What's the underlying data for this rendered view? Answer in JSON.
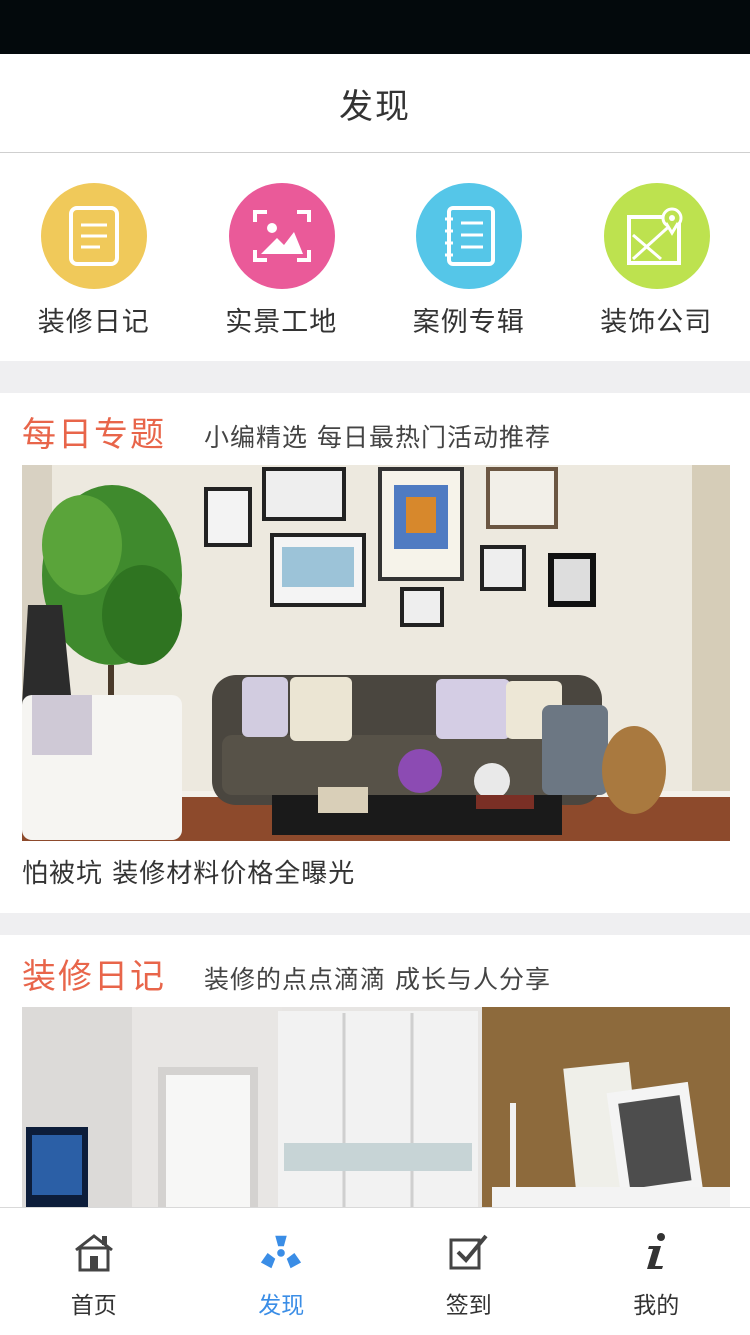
{
  "header": {
    "title": "发现"
  },
  "quick_links": [
    {
      "label": "装修日记",
      "icon": "notebook-icon",
      "color": "#f0c95a"
    },
    {
      "label": "实景工地",
      "icon": "photo-frame-icon",
      "color": "#ea5a99"
    },
    {
      "label": "案例专辑",
      "icon": "album-icon",
      "color": "#55c6e8"
    },
    {
      "label": "装饰公司",
      "icon": "map-pin-icon",
      "color": "#bde24f"
    }
  ],
  "sections": [
    {
      "title": "每日专题",
      "subtitle": "小编精选 每日最热门活动推荐",
      "image": "living-room-photo",
      "caption": "怕被坑 装修材料价格全曝光"
    },
    {
      "title": "装修日记",
      "subtitle": "装修的点点滴滴 成长与人分享",
      "image": "bedroom-wardrobe-photo"
    }
  ],
  "tabbar": [
    {
      "label": "首页",
      "icon": "home-icon",
      "active": false
    },
    {
      "label": "发现",
      "icon": "discover-icon",
      "active": true
    },
    {
      "label": "签到",
      "icon": "checkin-icon",
      "active": false
    },
    {
      "label": "我的",
      "icon": "info-icon",
      "active": false
    }
  ],
  "colors": {
    "accent": "#3a8de6",
    "section_title": "#e8654a",
    "status_bar": "#03090c"
  }
}
